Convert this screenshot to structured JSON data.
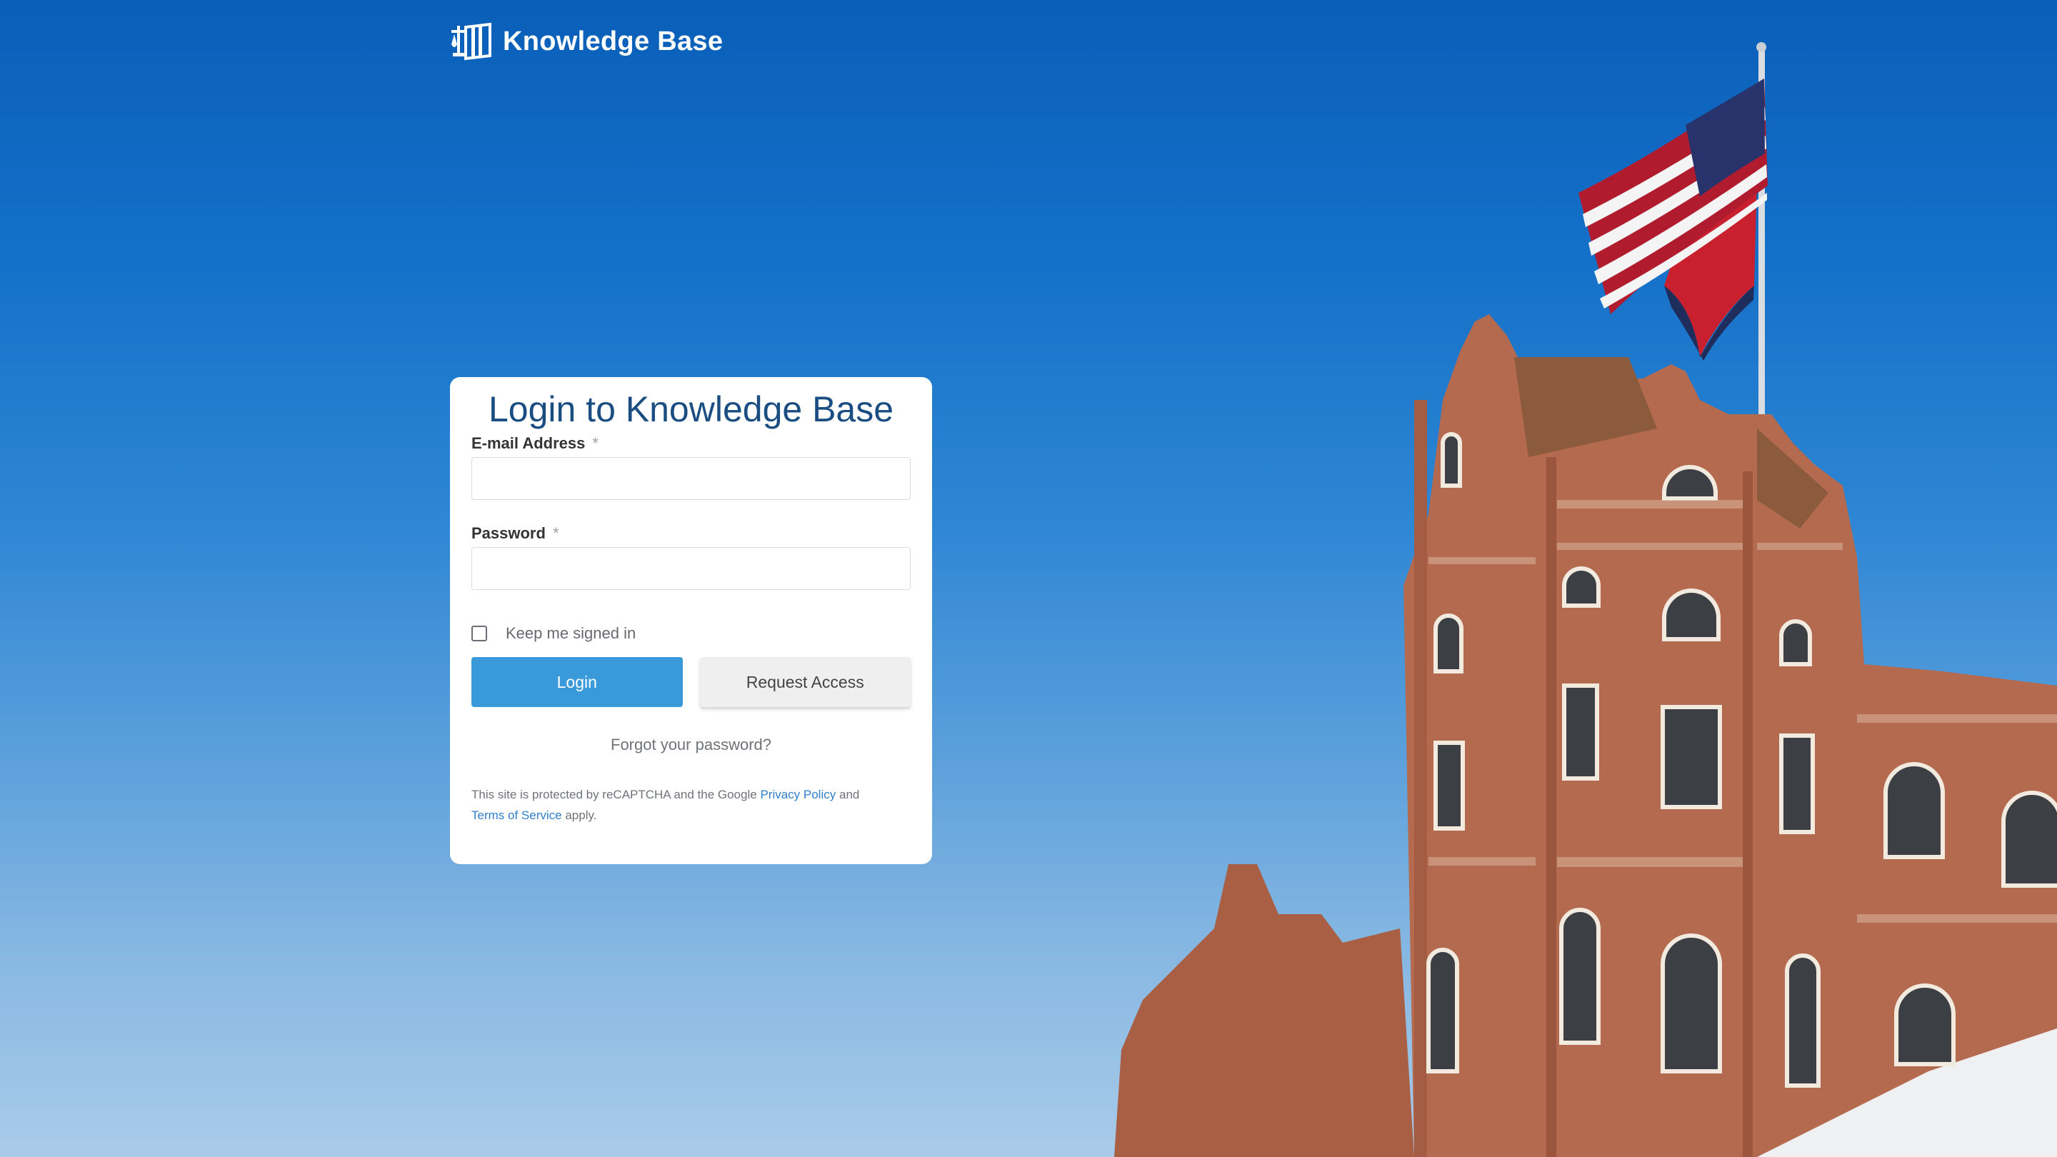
{
  "brand": {
    "name": "Knowledge Base",
    "icon": "book-scales-icon"
  },
  "login_card": {
    "title": "Login to Knowledge Base",
    "email": {
      "label": "E-mail Address",
      "required_marker": "*",
      "value": "",
      "placeholder": ""
    },
    "password": {
      "label": "Password",
      "required_marker": "*",
      "value": "",
      "placeholder": ""
    },
    "remember": {
      "label": "Keep me signed in",
      "checked": false
    },
    "login_button": "Login",
    "request_access_button": "Request Access",
    "forgot_password": "Forgot your password?",
    "legal": {
      "prefix": "This site is protected by reCAPTCHA and the Google",
      "privacy_link": "Privacy Policy",
      "middle": "and",
      "terms_link": "Terms of Service",
      "suffix": "apply."
    }
  },
  "colors": {
    "primary_button": "#3a9ad9",
    "title": "#1a4e82",
    "link": "#2f7fcc",
    "sky_top": "#0a5fb8",
    "sky_bottom": "#a9cbe9"
  }
}
